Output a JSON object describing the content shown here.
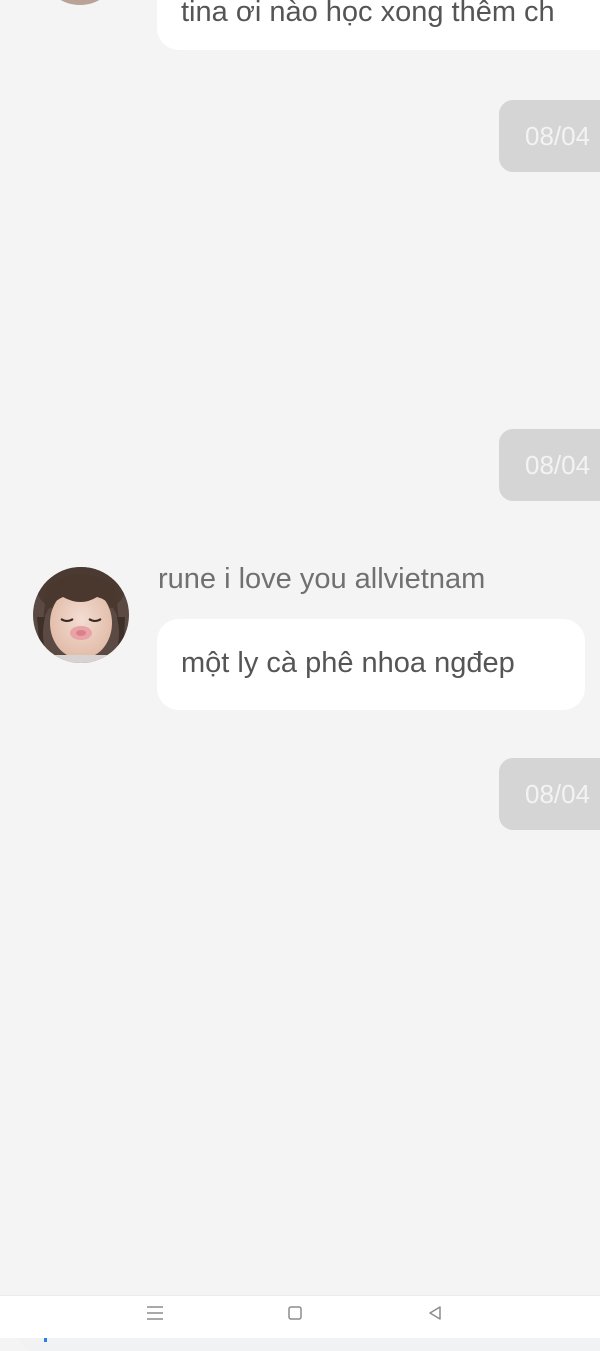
{
  "chat": {
    "messages": [
      {
        "sender": "",
        "text": "tina ơi nào học xong thêm ch"
      },
      {
        "sender": "rune i love you allvietnam",
        "text": "một ly cà phê nhoa ngđep"
      }
    ],
    "dates": [
      "08/04",
      "08/04",
      "08/04"
    ]
  },
  "icons": {
    "nav_menu": "menu-lines-icon",
    "nav_home": "square-home-icon",
    "nav_back": "triangle-back-icon",
    "avatar": "user-avatar-photo"
  },
  "colors": {
    "background": "#f4f4f4",
    "bubble": "#ffffff",
    "date_chip": "#d5d5d5",
    "caret": "#2d7fe0"
  }
}
